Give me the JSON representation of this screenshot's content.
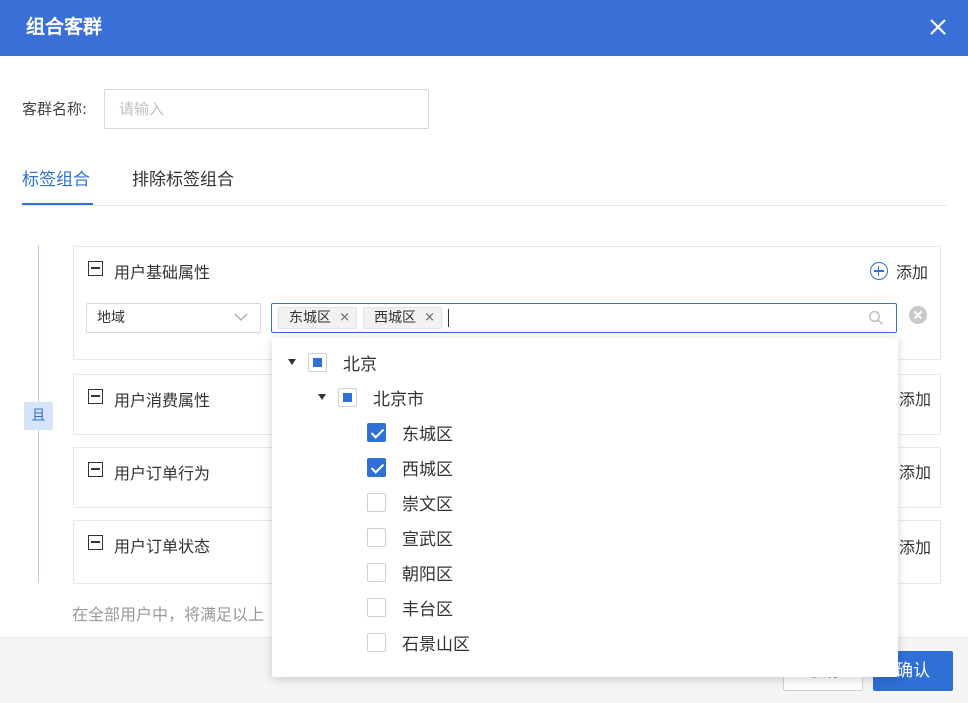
{
  "dialog": {
    "title": "组合客群"
  },
  "name_field": {
    "label": "客群名称:",
    "placeholder": "请输入"
  },
  "tabs": [
    {
      "label": "标签组合",
      "active": true
    },
    {
      "label": "排除标签组合",
      "active": false
    }
  ],
  "logic_badge": "且",
  "groups": [
    {
      "title": "用户基础属性",
      "add_label": "添加"
    },
    {
      "title": "用户消费属性",
      "add_label": "添加"
    },
    {
      "title": "用户订单行为",
      "add_label": "添加"
    },
    {
      "title": "用户订单状态",
      "add_label": "添加"
    }
  ],
  "condition": {
    "field": "地域",
    "selected_tags": [
      "东城区",
      "西城区"
    ],
    "remove_glyph": "×"
  },
  "tree": {
    "province": {
      "label": "北京",
      "state": "partial"
    },
    "city": {
      "label": "北京市",
      "state": "partial"
    },
    "districts": [
      {
        "label": "东城区",
        "checked": true
      },
      {
        "label": "西城区",
        "checked": true
      },
      {
        "label": "崇文区",
        "checked": false
      },
      {
        "label": "宣武区",
        "checked": false
      },
      {
        "label": "朝阳区",
        "checked": false
      },
      {
        "label": "丰台区",
        "checked": false
      },
      {
        "label": "石景山区",
        "checked": false
      }
    ]
  },
  "hint": "在全部用户中，将满足以上",
  "footer": {
    "cancel_label": "取消",
    "confirm_label": "确认"
  },
  "colors": {
    "primary": "#2f6fd6",
    "header": "#3a6fd8"
  }
}
